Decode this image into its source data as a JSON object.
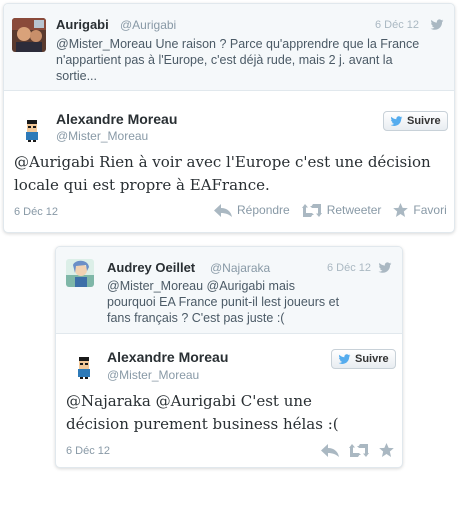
{
  "thread1": {
    "parent": {
      "name": "Aurigabi",
      "handle": "@Aurigabi",
      "date": "6 Déc 12",
      "text": "@Mister_Moreau Une raison ? Parce qu'apprendre que la France n'appartient pas à l'Europe, c'est déjà rude, mais 2 j. avant la sortie..."
    },
    "reply": {
      "name": "Alexandre Moreau",
      "handle": "@Mister_Moreau",
      "follow_label": "Suivre",
      "text": "@Aurigabi Rien à voir avec l'Europe c'est une décision locale qui est propre à EAFrance.",
      "date": "6 Déc 12",
      "reply_label": "Répondre",
      "retweet_label": "Retweeter",
      "favorite_label": "Favori"
    }
  },
  "thread2": {
    "parent": {
      "name": "Audrey Oeillet",
      "handle": "@Najaraka",
      "date": "6 Déc 12",
      "text": "@Mister_Moreau @Aurigabi mais pourquoi EA France punit-il lest joueurs et fans français ? C'est pas juste :("
    },
    "reply": {
      "name": "Alexandre Moreau",
      "handle": "@Mister_Moreau",
      "follow_label": "Suivre",
      "text": "@Najaraka @Aurigabi C'est une décision purement business hélas :(",
      "date": "6 Déc 12"
    }
  },
  "colors": {
    "twitter_blue": "#55acee",
    "muted": "#8899a6",
    "parent_bg": "#f5f8fa"
  },
  "icons": [
    "twitter-bird-icon",
    "reply-icon",
    "retweet-icon",
    "star-icon"
  ]
}
